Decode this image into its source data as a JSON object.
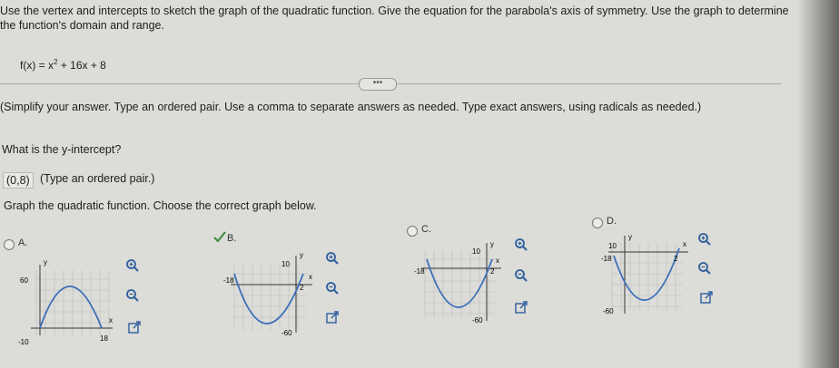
{
  "instructions": "Use the vertex and intercepts to sketch the graph of the quadratic function. Give the equation for the parabola's axis of symmetry. Use the graph to determine the function's domain and range.",
  "function": {
    "prefix": "f(x) = x",
    "exponent": "2",
    "suffix": " + 16x + 8"
  },
  "ellipsis": "•••",
  "simplify": "(Simplify your answer. Type an ordered pair. Use a comma to separate answers as needed. Type exact answers, using radicals as needed.)",
  "question_intercept": "What is the y-intercept?",
  "answer": {
    "value": "(0,8)",
    "hint": "(Type an ordered pair.)"
  },
  "question_graph": "Graph the quadratic function. Choose the correct graph below.",
  "options": [
    {
      "label": "A.",
      "axis": {
        "y": "y",
        "x": "x",
        "ytick": "60",
        "xleft": "-10",
        "xright": "18"
      }
    },
    {
      "label": "B.",
      "axis": {
        "y": "y",
        "x": "x",
        "ytick": "10",
        "xleft": "-18",
        "xright": "2",
        "ybottom": "-60"
      }
    },
    {
      "label": "C.",
      "axis": {
        "y": "y",
        "x": "x",
        "ytick": "10",
        "xleft": "-18",
        "xright": "2",
        "ybottom": "-60"
      }
    },
    {
      "label": "D.",
      "axis": {
        "y": "y",
        "x": "x",
        "ytick": "10",
        "xleft": "-18",
        "xright": "2",
        "ybottom": "-60"
      }
    }
  ],
  "icons": [
    "zoom-in-icon",
    "zoom-out-icon",
    "popout-icon",
    "cursor-check-icon"
  ]
}
